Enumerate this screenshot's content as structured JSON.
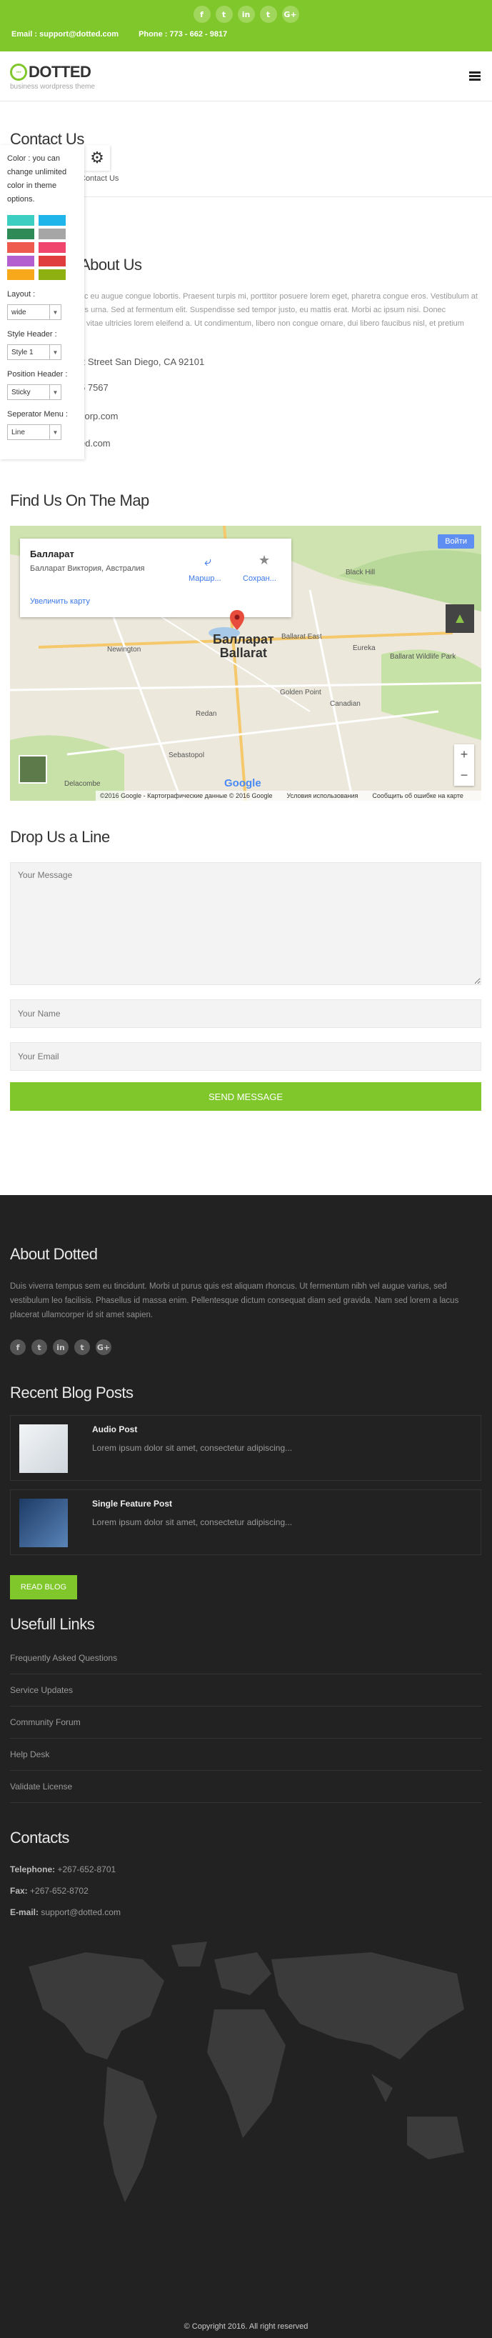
{
  "topbar": {
    "social": [
      "f",
      "t",
      "in",
      "t",
      "G+"
    ],
    "email_label": "Email :",
    "email": "support@dotted.com",
    "phone_label": "Phone :",
    "phone": "773 - 662 - 9817"
  },
  "header": {
    "logo_mark": "···",
    "logo_text": "DOTTED",
    "tagline": "business wordpress theme"
  },
  "page": {
    "title": "Contact Us",
    "breadcrumb": "Contact Us"
  },
  "about": {
    "title": "About Us",
    "paragraph": "Quisque sit amet nunc eu augue congue lobortis. Praesent turpis mi, porttitor posuere lorem eget, pharetra congue eros. Vestibulum at rhoncus dui, in lobortis urna. Sed at fermentum elit. Suspendisse sed tempor justo, eu mattis erat. Morbi ac ipsum nisi. Donec sollicitudin mattis est, vitae ultricies lorem eleifend a. Ut condimentum, libero non congue ornare, dui libero faucibus nisl, et pretium magna sapien a nisi.",
    "address": "2 Street San Diego, CA 92101",
    "phone": "5 7567",
    "email1": "corp.com",
    "email2": "ed.com"
  },
  "map": {
    "title": "Find Us On The Map",
    "place_name": "Балларат",
    "place_sub": "Балларат Виктория, Австралия",
    "zoom_link": "Увеличить карту",
    "directions": "Маршр...",
    "save": "Сохран...",
    "signin": "Войти",
    "city": "Балларат\nBallarat",
    "footer_copy": "©2016 Google - Картографические данные © 2016 Google",
    "footer_terms": "Условия использования",
    "footer_report": "Сообщить об ошибке на карте",
    "google": "Google",
    "places": {
      "black_hill": "Black Hill",
      "ballarat_east": "Ballarat East",
      "newington": "Newington",
      "eureka": "Eureka",
      "golden_point": "Golden Point",
      "canadian": "Canadian",
      "redan": "Redan",
      "sebastopol": "Sebastopol",
      "delacombe": "Delacombe",
      "wildlife": "Ballarat Wildlife Park"
    }
  },
  "form": {
    "title": "Drop Us a Line",
    "message_placeholder": "Your Message",
    "name_placeholder": "Your Name",
    "email_placeholder": "Your Email",
    "send": "SEND MESSAGE"
  },
  "footer": {
    "about_title": "About Dotted",
    "about_text": "Duis viverra tempus sem eu tincidunt. Morbi ut purus quis est aliquam rhoncus. Ut fermentum nibh vel augue varius, sed vestibulum leo facilisis. Phasellus id massa enim. Pellentesque dictum consequat diam sed gravida. Nam sed lorem a lacus placerat ullamcorper id sit amet sapien.",
    "social": [
      "f",
      "t",
      "in",
      "t",
      "G+"
    ],
    "blog_title": "Recent Blog Posts",
    "posts": [
      {
        "title": "Audio Post",
        "excerpt": "Lorem ipsum dolor sit amet, consectetur adipiscing..."
      },
      {
        "title": "Single Feature Post",
        "excerpt": "Lorem ipsum dolor sit amet, consectetur adipiscing..."
      }
    ],
    "read_blog": "READ BLOG",
    "links_title": "Usefull Links",
    "links": [
      "Frequently Asked Questions",
      "Service Updates",
      "Community Forum",
      "Help Desk",
      "Validate License"
    ],
    "contacts_title": "Contacts",
    "telephone_label": "Telephone:",
    "telephone": "+267-652-8701",
    "fax_label": "Fax:",
    "fax": "+267-652-8702",
    "email_label": "E-mail:",
    "email": "support@dotted.com",
    "copyright": "© Copyright 2016. All right reserved"
  },
  "switcher": {
    "intro": "Color : you can change unlimited color in theme options.",
    "colors": [
      "#3ccec0",
      "#1fb5ea",
      "#2e8b57",
      "#a6a6a6",
      "#ee5a4e",
      "#f0466d",
      "#b35fd0",
      "#e03e3e",
      "#f7a81b",
      "#8fb011"
    ],
    "layout_label": "Layout :",
    "layout_value": "wide",
    "style_header_label": "Style Header :",
    "style_header_value": "Style 1",
    "position_header_label": "Position Header :",
    "position_header_value": "Sticky",
    "separator_label": "Seperator Menu :",
    "separator_value": "Line"
  }
}
